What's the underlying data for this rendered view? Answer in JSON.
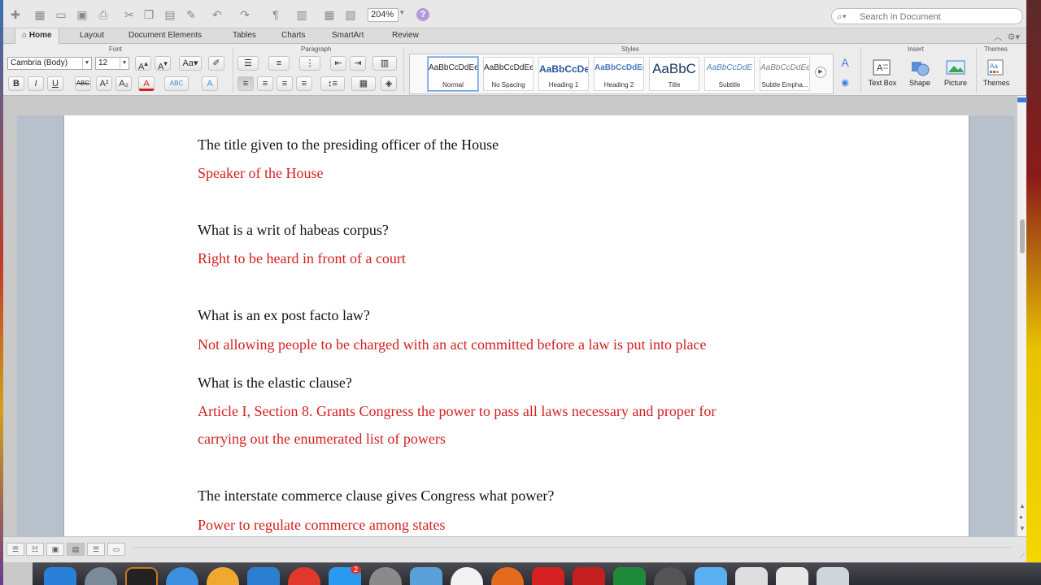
{
  "toolbar": {
    "zoom": "204%",
    "search_placeholder": "Search in Document"
  },
  "tabs": [
    "Home",
    "Layout",
    "Document Elements",
    "Tables",
    "Charts",
    "SmartArt",
    "Review"
  ],
  "ribbon": {
    "group_font": "Font",
    "group_paragraph": "Paragraph",
    "group_styles": "Styles",
    "group_insert": "Insert",
    "group_themes": "Themes",
    "font_name": "Cambria (Body)",
    "font_size": "12",
    "styles": [
      {
        "sample": "AaBbCcDdEe",
        "name": "Normal"
      },
      {
        "sample": "AaBbCcDdEe",
        "name": "No Spacing"
      },
      {
        "sample": "AaBbCcDe",
        "name": "Heading 1"
      },
      {
        "sample": "AaBbCcDdEe",
        "name": "Heading 2"
      },
      {
        "sample": "AaBbC",
        "name": "Title"
      },
      {
        "sample": "AaBbCcDdE",
        "name": "Subtitle"
      },
      {
        "sample": "AaBbCcDdEe",
        "name": "Subtle Empha..."
      }
    ],
    "insert": {
      "text_box": "Text Box",
      "shape": "Shape",
      "picture": "Picture"
    },
    "themes_label": "Themes"
  },
  "document": {
    "q1": "The title given to the presiding officer of the House",
    "a1": "Speaker of the House",
    "q2": "What is a writ of habeas corpus?",
    "a2": "Right to be heard in front of a court",
    "q3": "What is an ex post facto law?",
    "a3": "Not allowing people to be charged with an act committed before a law is put into place",
    "q4": "What is the elastic clause?",
    "a4_line1": "Article I, Section 8.  Grants Congress the power to pass all laws necessary and proper for",
    "a4_line2": "carrying out the enumerated list of powers",
    "q5": "The interstate commerce clause gives Congress what power?",
    "a5": "Power to regulate commerce among states"
  },
  "dock": {
    "badge_count": "2"
  },
  "colors": {
    "answer_red": "#d42020",
    "accent_blue": "#3a7ad8"
  }
}
